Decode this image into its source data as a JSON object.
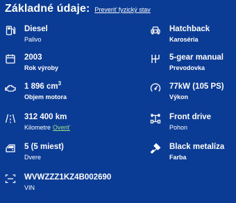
{
  "header": {
    "title": "Základné údaje:",
    "link": "Preveriť fyzický stav"
  },
  "left": [
    {
      "value": "Diesel",
      "label": "Palivo",
      "icon": "fuel-pump-icon"
    },
    {
      "value": "2003",
      "label": "Rok výroby",
      "icon": "calendar-icon"
    },
    {
      "value": "1 896 cm",
      "value_sup": "3",
      "label": "Objem motora",
      "icon": "engine-icon"
    },
    {
      "value": "312 400 km",
      "label": "Kilometre",
      "link": "Overiť",
      "icon": "road-icon"
    },
    {
      "value": "5 (5 miest)",
      "label": "Dvere",
      "icon": "car-door-icon"
    },
    {
      "value": "WVWZZZ1KZ4B002690",
      "label": "VIN",
      "icon": "vin-scan-icon"
    }
  ],
  "right": [
    {
      "value": "Hatchback",
      "label": "Karoséria",
      "icon": "car-front-icon"
    },
    {
      "value": "5-gear manual",
      "label": "Prevodovka",
      "icon": "gearbox-icon"
    },
    {
      "value": "77kW (105 PS)",
      "label": "Výkon",
      "icon": "speedometer-icon"
    },
    {
      "value": "Front drive",
      "label": "Pohon",
      "icon": "drivetrain-icon"
    },
    {
      "value": "Black metalíza",
      "label": "Farba",
      "icon": "paint-brush-icon"
    }
  ],
  "colors": {
    "background": "#0a3c96",
    "text": "#ffffff",
    "link_accent": "#9fe08a"
  }
}
